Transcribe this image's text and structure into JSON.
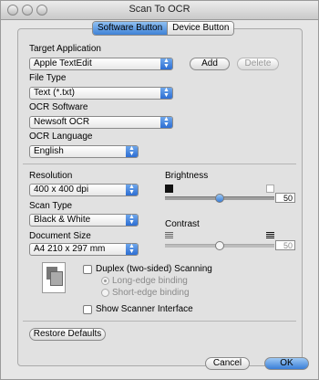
{
  "window": {
    "title": "Scan To OCR"
  },
  "tabs": [
    {
      "label": "Software Button",
      "active": true
    },
    {
      "label": "Device Button",
      "active": false
    }
  ],
  "target_application": {
    "label": "Target Application",
    "value": "Apple TextEdit",
    "add_button": "Add",
    "delete_button": "Delete"
  },
  "file_type": {
    "label": "File Type",
    "value": "Text (*.txt)"
  },
  "ocr_software": {
    "label": "OCR Software",
    "value": "Newsoft OCR"
  },
  "ocr_language": {
    "label": "OCR Language",
    "value": "English"
  },
  "resolution": {
    "label": "Resolution",
    "value": "400 x 400 dpi"
  },
  "scan_type": {
    "label": "Scan Type",
    "value": "Black & White"
  },
  "document_size": {
    "label": "Document Size",
    "value": "A4  210 x 297 mm"
  },
  "brightness": {
    "label": "Brightness",
    "value": "50"
  },
  "contrast": {
    "label": "Contrast",
    "value": "50"
  },
  "duplex": {
    "label": "Duplex (two-sided) Scanning",
    "long_edge": "Long-edge binding",
    "short_edge": "Short-edge binding"
  },
  "show_scanner": {
    "label": "Show Scanner Interface"
  },
  "buttons": {
    "restore_defaults": "Restore Defaults",
    "cancel": "Cancel",
    "ok": "OK"
  },
  "colors": {
    "accent": "#3f82d6",
    "panel": "#e1e1e1"
  }
}
